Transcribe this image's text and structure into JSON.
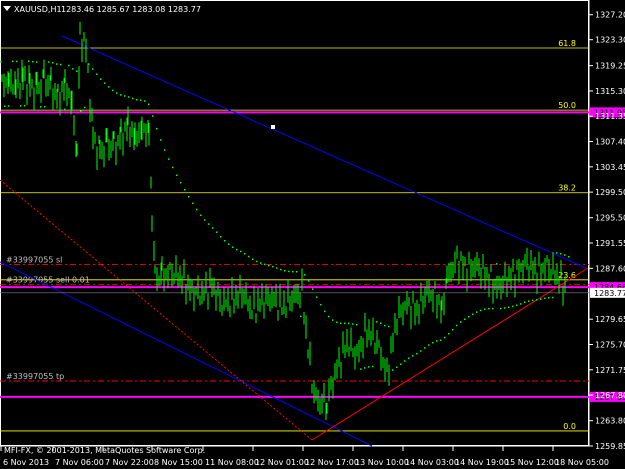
{
  "header": {
    "symbol_text": "XAUUSD,H1",
    "ohlc_text": "1283.46 1285.67 1283.08 1283.77"
  },
  "footer": {
    "copyright": "MFI-FX, © 2001-2013, MetaQuotes Software Corp."
  },
  "colors": {
    "background": "#000000",
    "frame": "#ffffff",
    "candles": "#00ff00",
    "ma_dots": "#00ff00",
    "fibo": "#ffff00",
    "channel": "#0000ff",
    "trendline": "#ff0000",
    "levels": "#ff00ff",
    "order_lines": "#ff0000"
  },
  "order_lines": [
    {
      "label": "#33997055 sl",
      "price": 1288.2
    },
    {
      "label": "#33997055 sell 0.01",
      "price": 1285.1
    },
    {
      "label": "#33997055 tp",
      "price": 1270.0
    }
  ],
  "fibonacci": {
    "name": "fibonacci-retracement",
    "levels": [
      {
        "label": "61.8",
        "price": 1322.0
      },
      {
        "label": "50.0",
        "price": 1312.3
      },
      {
        "label": "38.2",
        "price": 1299.4
      },
      {
        "label": "23.6",
        "price": 1285.8
      },
      {
        "label": "0.0",
        "price": 1262.2
      }
    ]
  },
  "horizontal_levels": [
    {
      "label": "1311.95",
      "price": 1311.95
    },
    {
      "label": "1284.66",
      "price": 1284.66
    },
    {
      "label": "1267.52",
      "price": 1267.52
    }
  ],
  "price_axis": {
    "ticks": [
      {
        "label": "1327.20",
        "price": 1327.2
      },
      {
        "label": "1323.30",
        "price": 1323.3
      },
      {
        "label": "1319.25",
        "price": 1319.25
      },
      {
        "label": "1315.30",
        "price": 1315.3
      },
      {
        "label": "1311.35",
        "price": 1311.35
      },
      {
        "label": "1307.40",
        "price": 1307.4
      },
      {
        "label": "1303.45",
        "price": 1303.45
      },
      {
        "label": "1299.50",
        "price": 1299.5
      },
      {
        "label": "1295.50",
        "price": 1295.5
      },
      {
        "label": "1291.55",
        "price": 1291.55
      },
      {
        "label": "1287.60",
        "price": 1287.6
      },
      {
        "label": "1279.65",
        "price": 1279.65
      },
      {
        "label": "1275.70",
        "price": 1275.7
      },
      {
        "label": "1271.75",
        "price": 1271.75
      },
      {
        "label": "1267.80",
        "price": 1267.8
      },
      {
        "label": "1263.80",
        "price": 1263.8
      },
      {
        "label": "1259.85",
        "price": 1259.85
      }
    ],
    "current_price": {
      "label": "1283.77",
      "price": 1283.77
    },
    "range": [
      1259.85,
      1329.5
    ]
  },
  "time_axis": {
    "ticks": [
      "6 Nov 2013",
      "7 Nov 06:00",
      "7 Nov 22:00",
      "8 Nov 15:00",
      "11 Nov 08:00",
      "12 Nov 01:00",
      "12 Nov 17:00",
      "13 Nov 10:00",
      "14 Nov 03:00",
      "14 Nov 19:00",
      "15 Nov 12:00",
      "18 Nov 05:00"
    ]
  },
  "chart_data": {
    "type": "line",
    "title": "XAUUSD,H1",
    "xlabel": "",
    "ylabel": "",
    "ylim": [
      1259.85,
      1329.5
    ],
    "x": [
      0,
      7,
      14,
      21,
      28,
      35,
      42,
      49,
      56,
      63,
      70,
      75,
      78,
      84,
      91,
      98,
      105,
      112,
      119,
      126,
      133,
      140,
      147,
      150,
      153,
      160,
      170,
      180,
      190,
      200,
      210,
      220,
      230,
      240,
      250,
      260,
      270,
      280,
      290,
      300,
      306,
      312,
      318,
      325,
      335,
      345,
      355,
      365,
      375,
      385,
      395,
      405,
      415,
      425,
      435,
      440,
      445,
      455,
      465,
      475,
      485,
      495,
      505,
      515,
      525,
      535,
      545,
      555,
      565
    ],
    "series": [
      {
        "values": [
          1316.5,
          1317.0,
          1316.0,
          1317.5,
          1316.0,
          1315.5,
          1317.0,
          1316.0,
          1314.0,
          1316.5,
          1313.5,
          1305.0,
          1324.0,
          1322.0,
          1308.0,
          1305.5,
          1307.0,
          1306.5,
          1308.0,
          1310.0,
          1308.0,
          1309.5,
          1309.0,
          1296.0,
          1286.0,
          1286.5,
          1287.0,
          1286.0,
          1284.0,
          1283.5,
          1285.0,
          1282.0,
          1282.5,
          1284.0,
          1281.0,
          1282.5,
          1283.0,
          1281.5,
          1283.0,
          1284.0,
          1275.0,
          1268.0,
          1266.5,
          1267.0,
          1272.0,
          1276.0,
          1274.0,
          1278.0,
          1276.0,
          1271.0,
          1280.0,
          1282.0,
          1281.0,
          1284.0,
          1283.0,
          1281.0,
          1286.0,
          1289.0,
          1287.5,
          1288.0,
          1286.5,
          1284.5,
          1286.0,
          1287.0,
          1288.5,
          1287.0,
          1288.0,
          1286.5,
          1284.0
        ]
      }
    ]
  }
}
